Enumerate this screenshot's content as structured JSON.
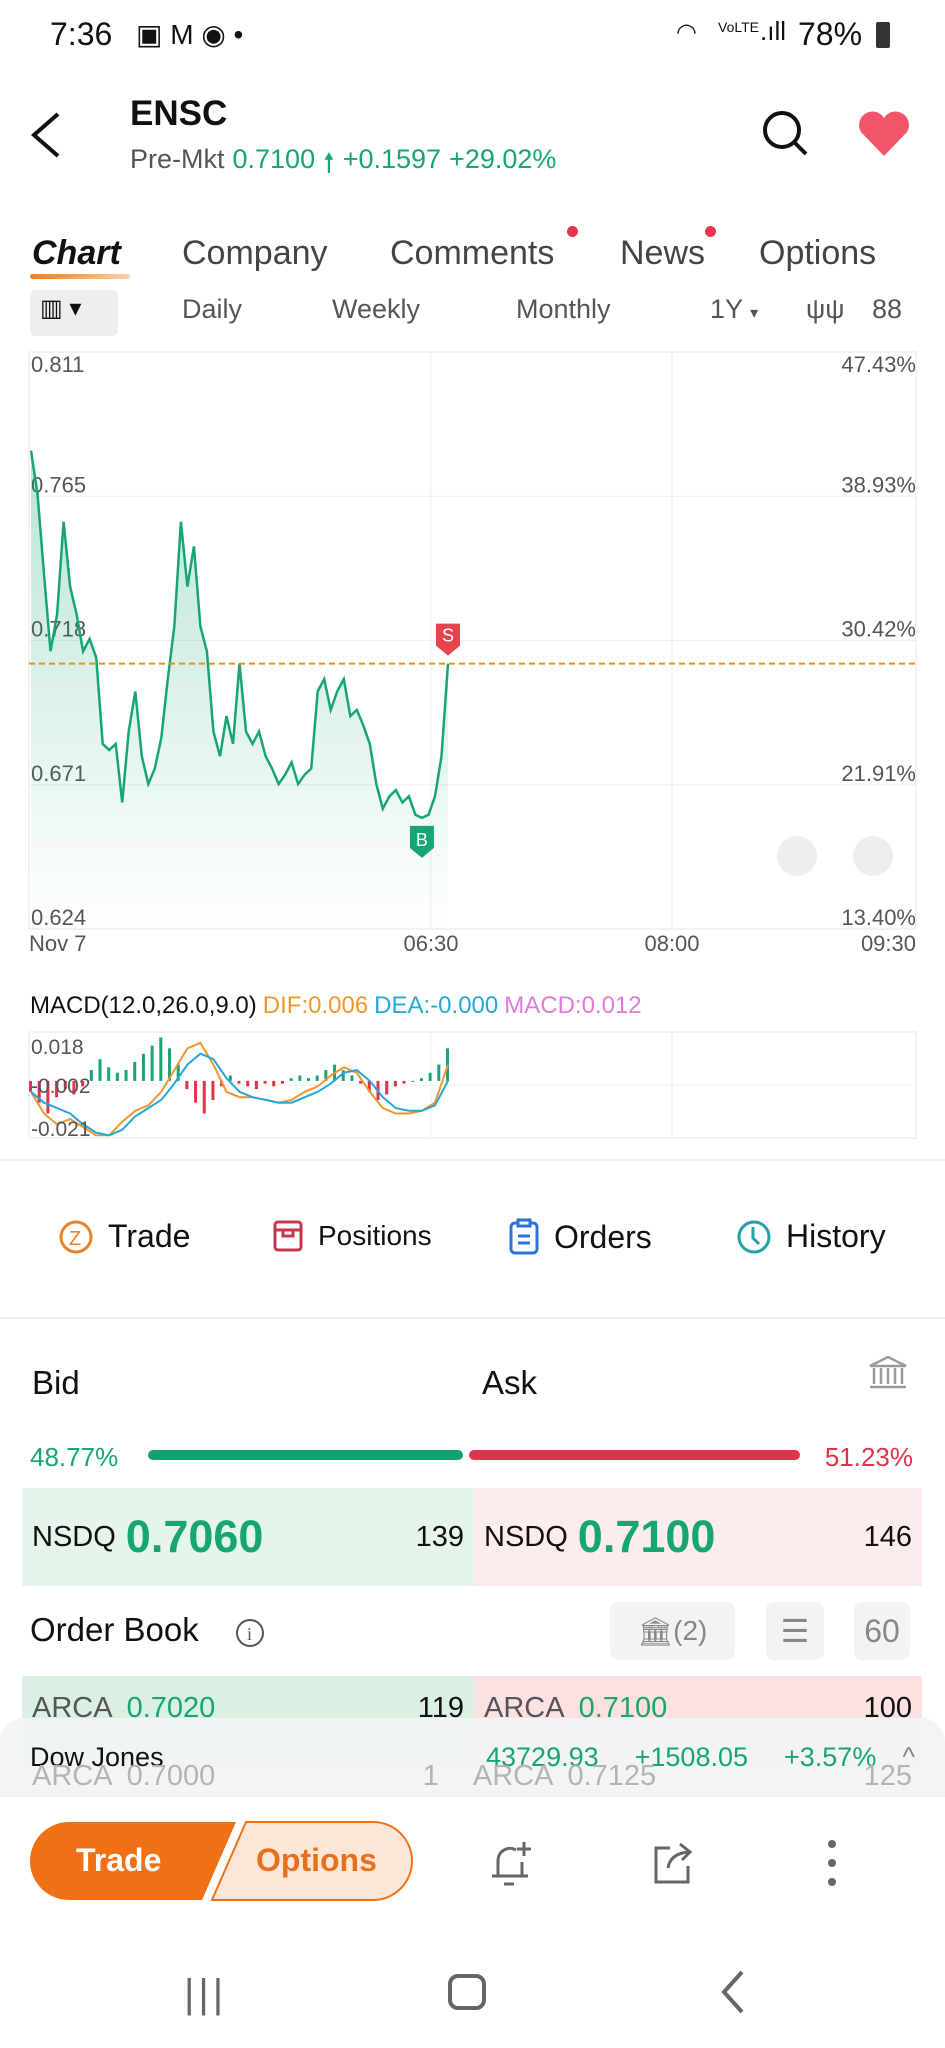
{
  "status": {
    "time": "7:36",
    "icons": [
      "image-icon",
      "gmail-icon",
      "chrome-icon",
      "dot-icon"
    ],
    "signal": "VoLTE",
    "battery": "78%"
  },
  "header": {
    "symbol": "ENSC",
    "session": "Pre-Mkt",
    "price": "0.7100",
    "change": "+0.1597",
    "change_pct": "+29.02%"
  },
  "tabs": [
    {
      "label": "Chart",
      "active": true
    },
    {
      "label": "Company"
    },
    {
      "label": "Comments",
      "dot": true
    },
    {
      "label": "News",
      "dot": true
    },
    {
      "label": "Options"
    }
  ],
  "chart_controls": {
    "periods": [
      "Daily",
      "Weekly",
      "Monthly"
    ],
    "range": "1Y"
  },
  "chart_data": [
    {
      "type": "line",
      "y_ticks": [
        "0.811",
        "0.765",
        "0.718",
        "0.671",
        "0.624"
      ],
      "pct_ticks": [
        "47.43%",
        "38.93%",
        "30.42%",
        "21.91%",
        "13.40%"
      ],
      "x_ticks": [
        "Nov 7",
        "06:30",
        "08:00",
        "09:30"
      ],
      "ylim": [
        0.624,
        0.811
      ],
      "last_price": 0.71,
      "markers": [
        {
          "label": "B",
          "side": "buy"
        },
        {
          "label": "S",
          "side": "sell"
        }
      ],
      "values": [
        0.779,
        0.765,
        0.739,
        0.714,
        0.726,
        0.756,
        0.735,
        0.726,
        0.714,
        0.718,
        0.712,
        0.684,
        0.682,
        0.684,
        0.665,
        0.688,
        0.701,
        0.68,
        0.671,
        0.676,
        0.686,
        0.705,
        0.722,
        0.756,
        0.735,
        0.748,
        0.722,
        0.714,
        0.688,
        0.68,
        0.693,
        0.684,
        0.71,
        0.688,
        0.684,
        0.688,
        0.68,
        0.676,
        0.671,
        0.674,
        0.678,
        0.671,
        0.674,
        0.676,
        0.701,
        0.705,
        0.695,
        0.701,
        0.705,
        0.693,
        0.695,
        0.69,
        0.684,
        0.671,
        0.663,
        0.667,
        0.669,
        0.665,
        0.667,
        0.661,
        0.66,
        0.661,
        0.667,
        0.68,
        0.71
      ],
      "line_color": "#17a673"
    },
    {
      "type": "bar",
      "title": "MACD(12.0,26.0,9.0)",
      "dif": "DIF:0.006",
      "dea": "DEA:-0.000",
      "macd": "MACD:0.012",
      "y_ticks": [
        "0.018",
        "-0.002",
        "-0.021"
      ],
      "ylim": [
        -0.021,
        0.018
      ],
      "histogram": [
        -0.004,
        -0.008,
        -0.012,
        -0.006,
        -0.003,
        -0.005,
        -0.002,
        0.004,
        0.008,
        0.005,
        0.003,
        0.004,
        0.007,
        0.01,
        0.013,
        0.016,
        0.012,
        0.006,
        -0.003,
        -0.008,
        -0.012,
        -0.007,
        -0.002,
        0.002,
        -0.001,
        -0.002,
        -0.003,
        -0.001,
        -0.002,
        -0.001,
        0.001,
        0.002,
        0.001,
        0.002,
        0.004,
        0.006,
        0.004,
        0.002,
        -0.001,
        -0.004,
        -0.007,
        -0.005,
        -0.002,
        -0.001,
        0,
        0.001,
        0.003,
        0.006,
        0.012
      ],
      "dif_series": [
        -0.004,
        -0.012,
        -0.016,
        -0.014,
        -0.017,
        -0.02,
        -0.02,
        -0.015,
        -0.011,
        -0.009,
        -0.004,
        0.004,
        0.012,
        0.014,
        0.006,
        -0.004,
        -0.006,
        -0.006,
        -0.007,
        -0.008,
        -0.007,
        -0.004,
        -0.002,
        0.002,
        0.005,
        0.003,
        -0.004,
        -0.01,
        -0.012,
        -0.012,
        -0.011,
        -0.008,
        0.006
      ],
      "dea_series": [
        -0.004,
        -0.008,
        -0.01,
        -0.012,
        -0.016,
        -0.019,
        -0.02,
        -0.018,
        -0.013,
        -0.01,
        -0.007,
        -0.001,
        0.006,
        0.01,
        0.008,
        0.001,
        -0.004,
        -0.006,
        -0.007,
        -0.008,
        -0.008,
        -0.006,
        -0.004,
        -0.001,
        0.003,
        0.004,
        0.0,
        -0.006,
        -0.01,
        -0.011,
        -0.011,
        -0.009,
        0.0
      ],
      "colors": {
        "dif": "#f0962f",
        "dea": "#25a8d6",
        "macd": "#e07ad8",
        "up": "#17a673",
        "down": "#e0324a"
      }
    }
  ],
  "actions": [
    {
      "label": "Trade",
      "icon": "trade-icon",
      "color": "#e8812a"
    },
    {
      "label": "Positions",
      "icon": "positions-icon",
      "color": "#c8344a"
    },
    {
      "label": "Orders",
      "icon": "orders-icon",
      "color": "#2a74d8"
    },
    {
      "label": "History",
      "icon": "history-icon",
      "color": "#1fa3a6"
    }
  ],
  "quote": {
    "bid_label": "Bid",
    "ask_label": "Ask",
    "bid_pct": "48.77%",
    "ask_pct": "51.23%",
    "bid_fraction": 0.4877,
    "bid": {
      "exchange": "NSDQ",
      "price": "0.7060",
      "size": "139"
    },
    "ask": {
      "exchange": "NSDQ",
      "price": "0.7100",
      "size": "146"
    }
  },
  "order_book": {
    "title": "Order Book",
    "brokers": "(2)",
    "depth": "60",
    "rows": [
      {
        "bid_ex": "ARCA",
        "bid": "0.7020",
        "bid_size": "119",
        "ask_ex": "ARCA",
        "ask": "0.7100",
        "ask_size": "100"
      },
      {
        "bid_ex": "ARCA",
        "bid": "0.7000",
        "bid_size": "1",
        "ask_ex": "ARCA",
        "ask": "0.7125",
        "ask_size": "125"
      }
    ]
  },
  "index_bar": {
    "name": "Dow Jones",
    "value": "43729.93",
    "change": "+1508.05",
    "change_pct": "+3.57%"
  },
  "bottom": {
    "trade": "Trade",
    "options": "Options"
  }
}
